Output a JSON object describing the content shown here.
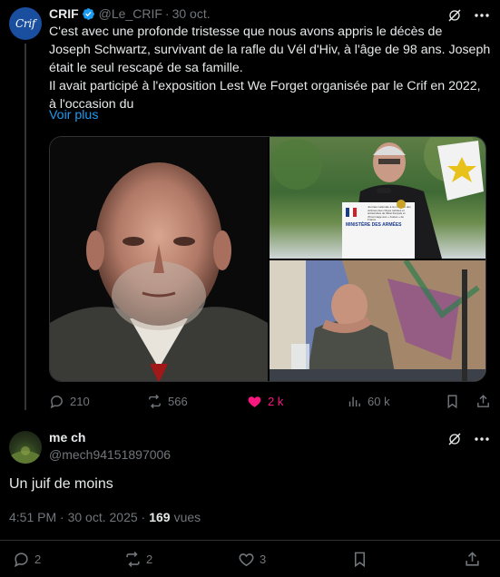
{
  "tweet": {
    "author_name": "CRIF",
    "author_handle": "@Le_CRIF",
    "avatar_text": "Crif",
    "date": "30 oct.",
    "text_lines": [
      "C'est avec une profonde tristesse que nous avons appris le décès de",
      "Joseph Schwartz, survivant de la rafle du Vél d'Hiv, à l'âge de 98 ans. Joseph",
      "était le seul rescapé de sa famille.",
      "Il avait participé à l'exposition Lest We Forget organisée par le Crif en 2022,",
      "à l'occasion du"
    ],
    "see_more": "Voir plus",
    "media_captions": {
      "podium_label": "MINISTÈRE DES ARMÉES",
      "podium_text": "Journée nationale à la mémoire des victimes des crimes racistes et antisémites de l'État français et d'hommage aux « Justes » de France"
    },
    "actions": {
      "replies": "210",
      "reposts": "566",
      "likes": "2 k",
      "views": "60 k"
    }
  },
  "reply": {
    "author_name": "me ch",
    "author_handle": "@mech94151897006",
    "text": "Un juif de moins",
    "time": "4:51 PM",
    "date": "30 oct. 2025",
    "views_count": "169",
    "views_label": "vues",
    "actions": {
      "replies": "2",
      "reposts": "2",
      "likes": "3"
    }
  },
  "colors": {
    "background": "#000000",
    "text": "#e7e9ea",
    "muted": "#71767b",
    "link": "#1d9bf0",
    "like": "#f91880",
    "verified": "#1d9bf0"
  },
  "icons": [
    "verified-badge-icon",
    "grok-icon",
    "more-icon",
    "reply-icon",
    "repost-icon",
    "like-icon",
    "views-icon",
    "bookmark-icon",
    "share-icon"
  ]
}
